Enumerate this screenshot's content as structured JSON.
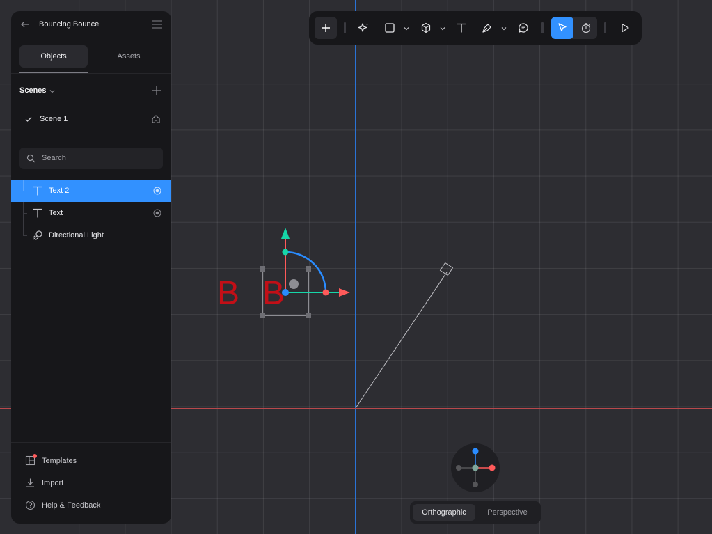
{
  "project": {
    "title": "Bouncing Bounce"
  },
  "panel": {
    "tabs": [
      {
        "label": "Objects",
        "active": true
      },
      {
        "label": "Assets",
        "active": false
      }
    ],
    "scenes": {
      "label": "Scenes",
      "items": [
        {
          "name": "Scene 1",
          "active": true
        }
      ]
    },
    "search": {
      "placeholder": "Search"
    },
    "layers": [
      {
        "label": "Text 2",
        "icon": "text-icon",
        "selected": true
      },
      {
        "label": "Text",
        "icon": "text-icon",
        "selected": false
      },
      {
        "label": "Directional Light",
        "icon": "directional-light-icon",
        "selected": false
      }
    ],
    "footer": [
      {
        "label": "Templates",
        "icon": "templates-icon",
        "notification": true
      },
      {
        "label": "Import",
        "icon": "import-icon"
      },
      {
        "label": "Help & Feedback",
        "icon": "help-icon"
      }
    ]
  },
  "toolbar": {
    "tools": [
      "add-icon",
      "ai-sparkle-icon",
      "rectangle-icon",
      "cube-icon",
      "text-icon",
      "pen-icon",
      "comment-icon",
      "select-cursor-icon",
      "timer-icon",
      "play-icon"
    ],
    "active_tool": "select-cursor-icon"
  },
  "viewport": {
    "text_objects": [
      {
        "text": "B"
      },
      {
        "text": "B"
      }
    ],
    "text_color": "#c20f17"
  },
  "view_toggle": {
    "options": [
      {
        "label": "Orthographic",
        "active": true
      },
      {
        "label": "Perspective",
        "active": false
      }
    ]
  },
  "colors": {
    "accent": "#3291ff",
    "panel_bg": "#17171a",
    "canvas_bg": "#2d2d32",
    "axis_x": "#ff5a5a",
    "axis_y": "#16d6a8",
    "axis_z": "#2a8cff"
  }
}
